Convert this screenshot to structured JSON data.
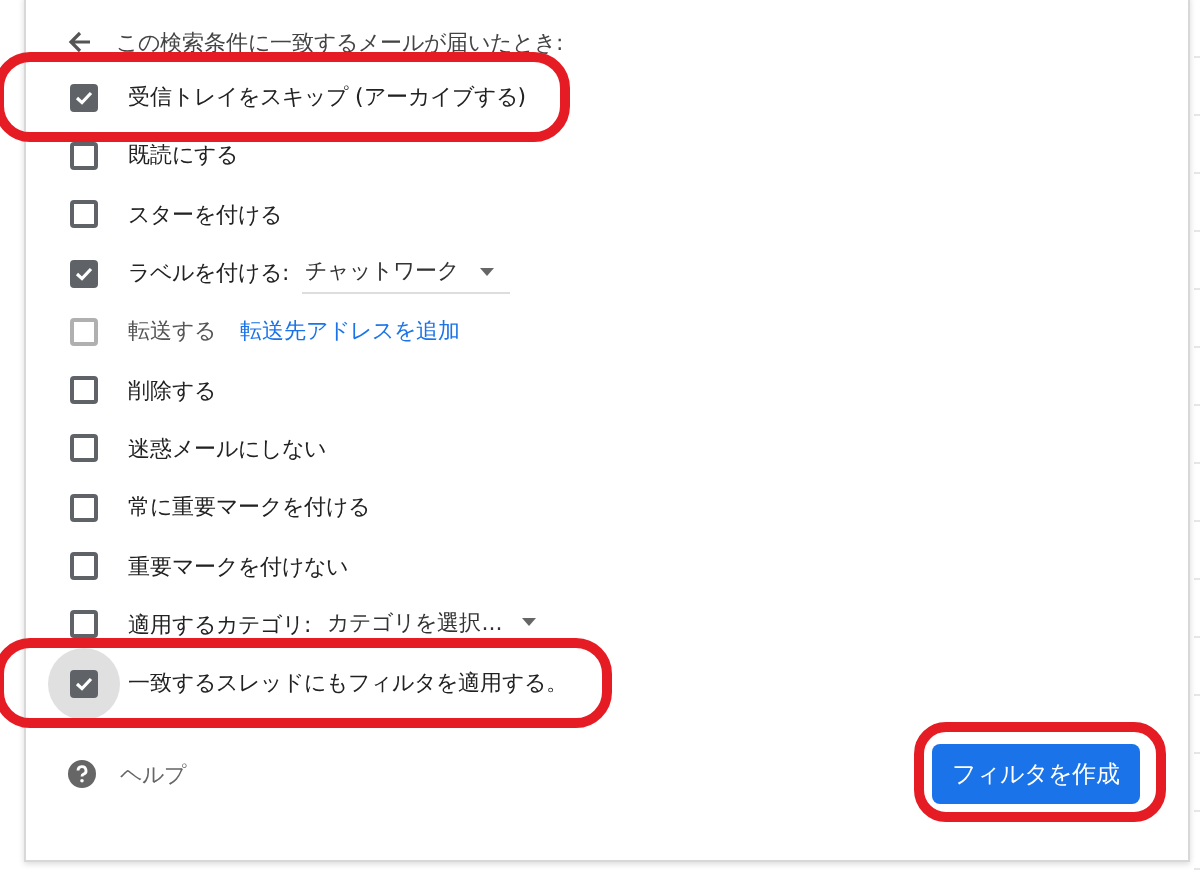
{
  "header": {
    "title": "この検索条件に一致するメールが届いたとき:"
  },
  "options": [
    {
      "kind": "plain",
      "label": "受信トレイをスキップ (アーカイブする)",
      "checked": true,
      "highlighted": true
    },
    {
      "kind": "plain",
      "label": "既読にする",
      "checked": false,
      "highlighted": false
    },
    {
      "kind": "plain",
      "label": "スターを付ける",
      "checked": false,
      "highlighted": false
    },
    {
      "kind": "select",
      "label": "ラベルを付ける:",
      "value": "チャットワーク",
      "checked": true,
      "highlighted": false
    },
    {
      "kind": "link",
      "label": "転送する",
      "link": "転送先アドレスを追加",
      "checked": false,
      "disabled": true,
      "highlighted": false
    },
    {
      "kind": "plain",
      "label": "削除する",
      "checked": false,
      "highlighted": false
    },
    {
      "kind": "plain",
      "label": "迷惑メールにしない",
      "checked": false,
      "highlighted": false
    },
    {
      "kind": "plain",
      "label": "常に重要マークを付ける",
      "checked": false,
      "highlighted": false
    },
    {
      "kind": "plain",
      "label": "重要マークを付けない",
      "checked": false,
      "highlighted": false
    },
    {
      "kind": "select",
      "label": "適用するカテゴリ:",
      "value": "カテゴリを選択...",
      "checked": false,
      "highlighted": false
    },
    {
      "kind": "plain",
      "label": "一致するスレッドにもフィルタを適用する。",
      "checked": true,
      "focused": true,
      "highlighted": true
    }
  ],
  "help": {
    "label": "ヘルプ"
  },
  "create_button": {
    "label": "フィルタを作成",
    "highlighted": true
  }
}
